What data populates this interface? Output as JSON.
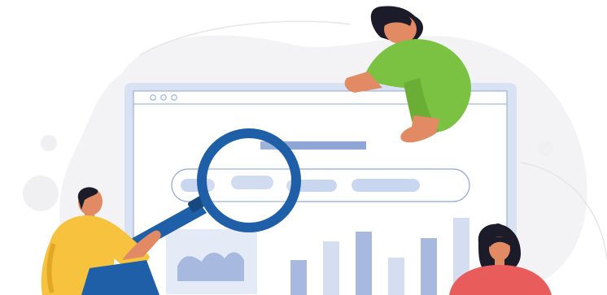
{
  "illustration": {
    "colors": {
      "blob": "#f3f3f5",
      "window_frame": "#d9e2f3",
      "window_border": "#8ea6d6",
      "accent_blue": "#1f5fa8",
      "pill": "#c9d6ef",
      "bar_dark": "#a7b9df",
      "bar_light": "#d5def1",
      "green_shirt": "#7cc242",
      "yellow_shirt": "#f7c33e",
      "red_shirt": "#e85d5b",
      "skin": "#e28a63",
      "hair": "#1b1b2a"
    },
    "icons": {
      "window_dots": "window-control-dots-icon",
      "search": "magnifying-glass-icon"
    }
  }
}
